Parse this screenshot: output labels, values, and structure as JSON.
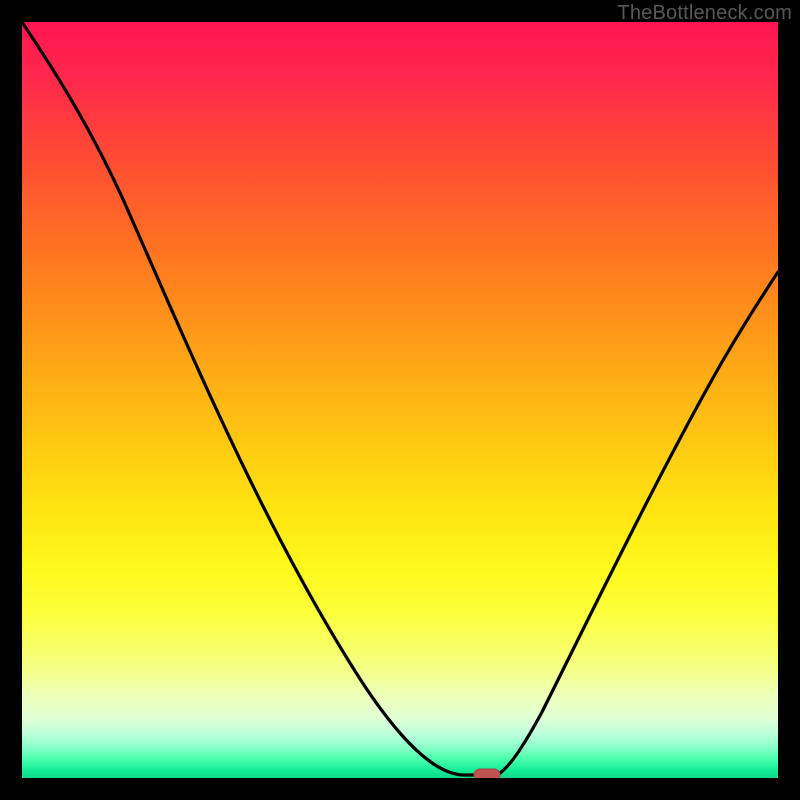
{
  "watermark": "TheBottleneck.com",
  "colors": {
    "frame": "#000000",
    "curve_stroke": "#000000",
    "marker_fill": "#c05454",
    "marker_stroke": "#a84444"
  },
  "chart_data": {
    "type": "line",
    "title": "",
    "xlabel": "",
    "ylabel": "",
    "xlim": [
      0,
      100
    ],
    "ylim": [
      0,
      100
    ],
    "grid": false,
    "legend": false,
    "series": [
      {
        "name": "left-curve",
        "x": [
          0,
          5,
          10,
          15,
          20,
          25,
          30,
          35,
          40,
          45,
          50,
          55,
          58,
          60,
          62
        ],
        "y": [
          100,
          92,
          84,
          75,
          66,
          57,
          48,
          39,
          31,
          23,
          15,
          8,
          3,
          1,
          0
        ]
      },
      {
        "name": "right-curve",
        "x": [
          63,
          66,
          70,
          75,
          80,
          85,
          90,
          95,
          100
        ],
        "y": [
          0,
          3,
          10,
          20,
          31,
          42,
          52,
          60,
          67
        ]
      },
      {
        "name": "flat-segment",
        "x": [
          58,
          63
        ],
        "y": [
          0,
          0
        ]
      }
    ],
    "marker": {
      "x": 61,
      "y": 0,
      "shape": "rounded-rect",
      "color": "#c05454"
    },
    "gradient_stops": [
      {
        "pos": 0.0,
        "color": "#ff1452"
      },
      {
        "pos": 0.5,
        "color": "#ffc512"
      },
      {
        "pos": 0.78,
        "color": "#fcff3a"
      },
      {
        "pos": 0.96,
        "color": "#8affc8"
      },
      {
        "pos": 1.0,
        "color": "#0ed98a"
      }
    ]
  }
}
